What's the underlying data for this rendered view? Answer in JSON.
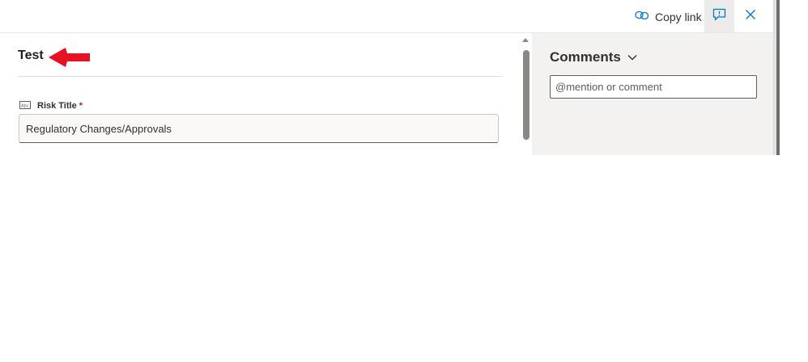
{
  "toolbar": {
    "copy_link_label": "Copy link",
    "icons": {
      "copy_link": "link-icon",
      "comments": "comment-icon",
      "close": "close-icon"
    }
  },
  "form": {
    "title": "Test",
    "fields": [
      {
        "icon": "text-field-icon",
        "label": "Risk Title",
        "required_marker": "*",
        "value": "Regulatory Changes/Approvals"
      }
    ]
  },
  "comments": {
    "title": "Comments",
    "input_placeholder": "@mention or comment"
  },
  "colors": {
    "accent": "#0078d4",
    "annotation_arrow": "#e81123",
    "comments_bg": "#f3f2f1"
  }
}
